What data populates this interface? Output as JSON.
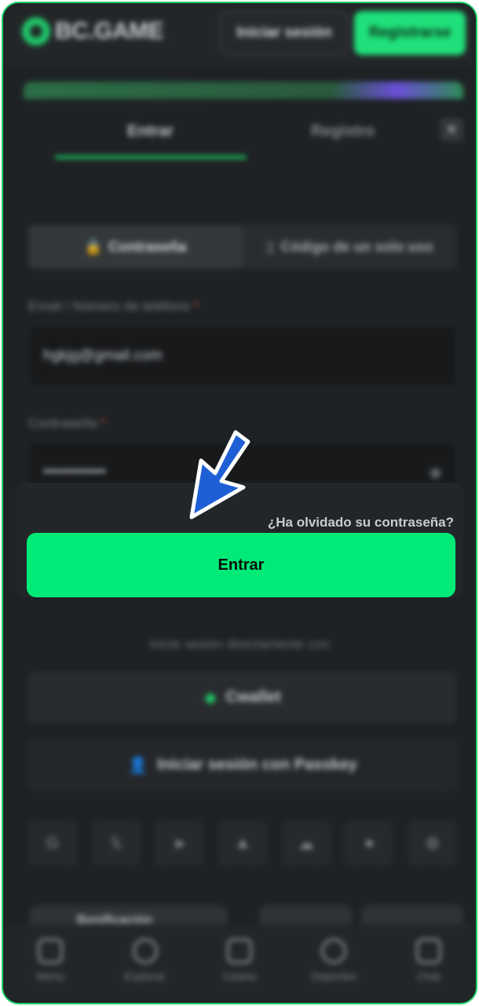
{
  "header": {
    "logo_text": "BC.GAME",
    "login_label": "Iniciar sesión",
    "register_label": "Registrarse"
  },
  "tabs": [
    {
      "label": "Entrar",
      "active": true
    },
    {
      "label": "Registro",
      "active": false
    }
  ],
  "close_label": "✕",
  "login_methods": [
    {
      "label": "Contraseña",
      "icon": "lock-icon",
      "active": true
    },
    {
      "label": "Código de un solo uso",
      "icon": "phone-icon",
      "active": false
    }
  ],
  "form": {
    "email_label": "Email / Número de teléfono",
    "email_value": "hgkjg@gmail.com",
    "password_label": "Contraseña",
    "password_value": "••••••••••••",
    "required_mark": "*",
    "forgot_label": "¿Ha olvidado su contraseña?",
    "submit_label": "Entrar"
  },
  "alt_login": {
    "direct_text": "Inicie sesión directamente con",
    "cwallet_label": "Cwallet",
    "passkey_label": "Iniciar sesión con Passkey",
    "social_icons": [
      "google-icon",
      "x-icon",
      "telegram-icon",
      "metamask-icon",
      "line-icon",
      "whatsapp-icon",
      "steam-icon"
    ]
  },
  "promo_bottom_text": "Bonificación",
  "bottom_nav": [
    {
      "label": "Menú",
      "icon": "menu-icon"
    },
    {
      "label": "Explorar",
      "icon": "search-icon"
    },
    {
      "label": "Casino",
      "icon": "casino-icon"
    },
    {
      "label": "Deportes",
      "icon": "sports-icon"
    },
    {
      "label": "Chat",
      "icon": "chat-icon"
    }
  ],
  "colors": {
    "accent": "#00ea77",
    "background": "#1f2224",
    "arrow": "#1f5fd6"
  }
}
